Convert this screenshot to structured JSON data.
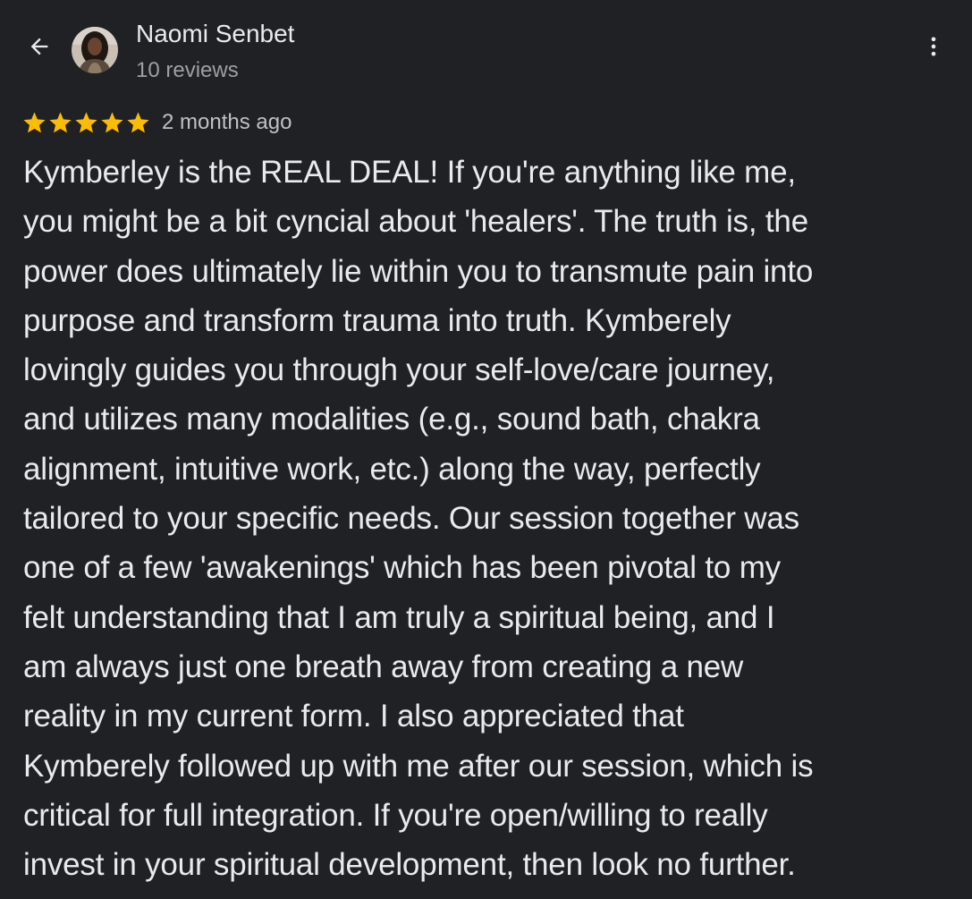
{
  "header": {
    "back_icon": "arrow-back-icon",
    "author_name": "Naomi Senbet",
    "author_reviews": "10 reviews",
    "more_icon": "more-vertical-icon"
  },
  "rating": {
    "stars": 5,
    "max_stars": 5,
    "star_color": "#fbbc04",
    "time_ago": "2 months ago"
  },
  "review": {
    "lines": [
      "Kymberley is the REAL DEAL! If you're anything like me,",
      "you might be a bit cyncial about 'healers'. The truth is, the",
      "power does ultimately lie within you to transmute pain into",
      "purpose and transform trauma into truth. Kymberely",
      "lovingly guides you through your self-love/care journey,",
      "and utilizes many modalities (e.g., sound bath, chakra",
      "alignment, intuitive work, etc.) along the way, perfectly",
      "tailored to your specific needs. Our session together was",
      "one of a few 'awakenings' which has been pivotal to my",
      "felt understanding that I am truly a spiritual being, and I",
      "am always just one breath away from creating a new",
      "reality in my current form. I also appreciated that",
      "Kymberely followed up with me after our session, which is",
      "critical for full integration. If you're open/willing to really",
      "invest in your spiritual development, then look no further."
    ]
  },
  "colors": {
    "background": "#202124",
    "primary_text": "#e8eaed",
    "secondary_text": "#9aa0a6"
  }
}
